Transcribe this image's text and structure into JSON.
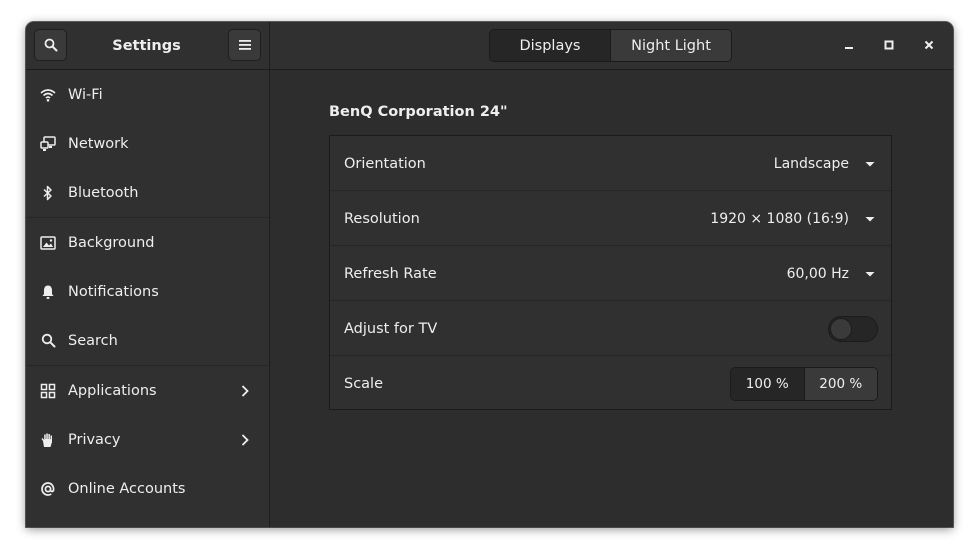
{
  "window": {
    "title": "Settings",
    "tabs": [
      {
        "label": "Displays",
        "active": true
      },
      {
        "label": "Night Light",
        "active": false
      }
    ],
    "controls": [
      "minimize-icon",
      "maximize-icon",
      "close-icon"
    ]
  },
  "sidebar": {
    "items": [
      {
        "label": "Wi-Fi",
        "icon": "wifi-icon"
      },
      {
        "label": "Network",
        "icon": "network-icon"
      },
      {
        "label": "Bluetooth",
        "icon": "bluetooth-icon"
      },
      {
        "label": "Background",
        "icon": "background-icon"
      },
      {
        "label": "Notifications",
        "icon": "bell-icon"
      },
      {
        "label": "Search",
        "icon": "search-icon"
      },
      {
        "label": "Applications",
        "icon": "applications-icon",
        "has_submenu": true
      },
      {
        "label": "Privacy",
        "icon": "hand-icon",
        "has_submenu": true
      },
      {
        "label": "Online Accounts",
        "icon": "at-icon"
      }
    ]
  },
  "display": {
    "monitor_name": "BenQ Corporation 24\"",
    "rows": {
      "orientation": {
        "label": "Orientation",
        "value": "Landscape"
      },
      "resolution": {
        "label": "Resolution",
        "value": "1920 × 1080 (16:9)"
      },
      "refresh_rate": {
        "label": "Refresh Rate",
        "value": "60,00 Hz"
      },
      "adjust_tv": {
        "label": "Adjust for TV",
        "enabled": false
      },
      "scale": {
        "label": "Scale",
        "options": [
          "100 %",
          "200 %"
        ],
        "selected": "100 %"
      }
    }
  },
  "colors": {
    "background": "#2d2d2d",
    "sidebar": "#303030",
    "text": "#eeeeec",
    "active_button": "#262626",
    "button": "#3a3a3a"
  }
}
